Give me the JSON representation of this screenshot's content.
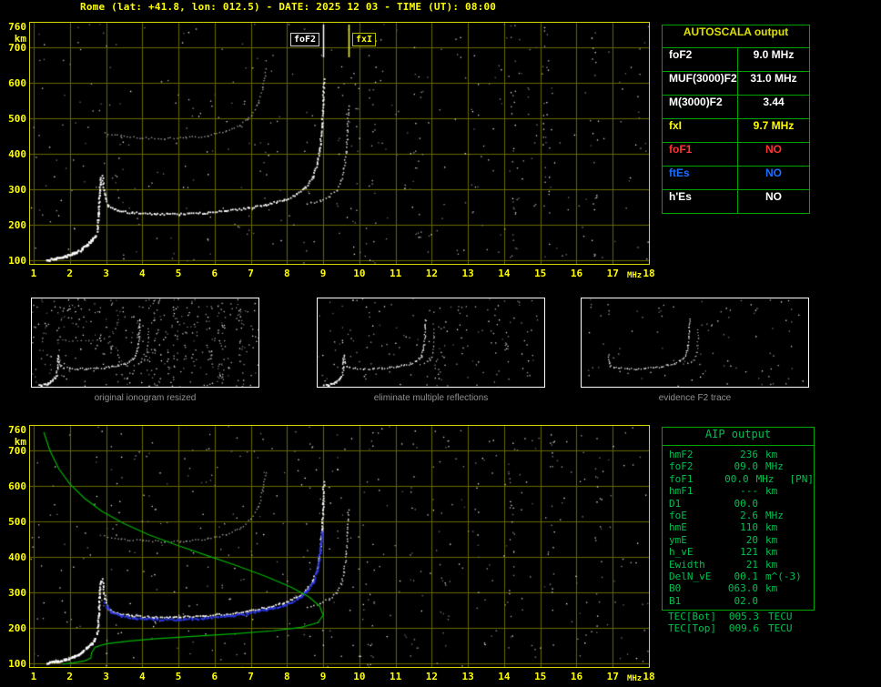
{
  "title": "Rome (lat: +41.8, lon: 012.5) - DATE: 2025 12 03 - TIME (UT): 08:00",
  "colors": {
    "background": "#000000",
    "yellow": "#ffff00",
    "plot_border": "#d8d800",
    "grid": "#666600",
    "table_border": "#00a400",
    "autoscala_header": "#dde000",
    "aip_text": "#00c050",
    "caption_gray": "#909090",
    "white": "#ffffff",
    "red": "#ff3333",
    "blue": "#1a6eff"
  },
  "autoscala_table": {
    "title": "AUTOSCALA output",
    "rows": [
      {
        "param": "foF2",
        "value": "9.0 MHz",
        "color": "#ffffff"
      },
      {
        "param": "MUF(3000)F2",
        "value": "31.0 MHz",
        "color": "#ffffff"
      },
      {
        "param": "M(3000)F2",
        "value": "3.44",
        "color": "#ffffff"
      },
      {
        "param": "fxI",
        "value": "9.7 MHz",
        "color": "#ffff00"
      },
      {
        "param": "foF1",
        "value": "NO",
        "color": "#ff3333"
      },
      {
        "param": "ftEs",
        "value": "NO",
        "color": "#1a6eff"
      },
      {
        "param": "h'Es",
        "value": "NO",
        "color": "#ffffff"
      }
    ]
  },
  "panels": [
    {
      "caption": "original ionogram resized"
    },
    {
      "caption": "eliminate multiple reflections"
    },
    {
      "caption": "evidence F2 trace"
    }
  ],
  "aip_table": {
    "title": "AIP output",
    "rows": [
      {
        "param": "hmF2",
        "value": "236",
        "unit": "km",
        "note": ""
      },
      {
        "param": "foF2",
        "value": "09.0",
        "unit": "MHz",
        "note": ""
      },
      {
        "param": "foF1",
        "value": "00.0",
        "unit": "MHz",
        "note": "[PN]"
      },
      {
        "param": "hmF1",
        "value": "---",
        "unit": "km",
        "note": ""
      },
      {
        "param": "D1",
        "value": "00.0",
        "unit": "",
        "note": ""
      },
      {
        "param": "foE",
        "value": "2.6",
        "unit": "MHz",
        "note": ""
      },
      {
        "param": "hmE",
        "value": "110",
        "unit": "km",
        "note": ""
      },
      {
        "param": "ymE",
        "value": "20",
        "unit": "km",
        "note": ""
      },
      {
        "param": "h_vE",
        "value": "121",
        "unit": "km",
        "note": ""
      },
      {
        "param": "Ewidth",
        "value": "21",
        "unit": "km",
        "note": ""
      },
      {
        "param": "DelN_vE",
        "value": "00.1",
        "unit": "m^(-3)",
        "note": ""
      },
      {
        "param": "B0",
        "value": "063.0",
        "unit": "km",
        "note": ""
      },
      {
        "param": "B1",
        "value": "02.0",
        "unit": "",
        "note": ""
      }
    ],
    "tec_rows": [
      {
        "param": "TEC[Bot]",
        "value": "005.3",
        "unit": "TECU"
      },
      {
        "param": "TEC[Top]",
        "value": "009.6",
        "unit": "TECU"
      }
    ]
  },
  "chart_data": [
    {
      "id": "scaled-ionogram",
      "type": "scatter",
      "title": "",
      "xlabel": "MHz",
      "ylabel": "km",
      "xlim": [
        0.9,
        18.0
      ],
      "ylim": [
        90,
        770
      ],
      "xticks": [
        1,
        2,
        3,
        4,
        5,
        6,
        7,
        8,
        9,
        10,
        11,
        12,
        13,
        14,
        15,
        16,
        17,
        18
      ],
      "yticks": [
        760,
        700,
        600,
        500,
        400,
        300,
        200,
        100
      ],
      "grid": true,
      "legend": "none",
      "annotations": [
        {
          "label": "foF2",
          "x": 9.0,
          "color": "#ffffff"
        },
        {
          "label": "fxI",
          "x": 9.7,
          "color": "#ffff00"
        }
      ],
      "series": [
        {
          "name": "E-region-trace",
          "color": "#ffffff",
          "size": 2.4,
          "step": 1.6,
          "points": [
            [
              1.35,
              103
            ],
            [
              1.6,
              107
            ],
            [
              1.85,
              113
            ],
            [
              2.1,
              122
            ],
            [
              2.3,
              133
            ],
            [
              2.45,
              145
            ],
            [
              2.58,
              158
            ],
            [
              2.68,
              172
            ]
          ]
        },
        {
          "name": "F-cusp",
          "color": "#ffffff",
          "size": 2.0,
          "step": 2.0,
          "points": [
            [
              2.74,
              185
            ],
            [
              2.78,
              235
            ],
            [
              2.8,
              285
            ],
            [
              2.83,
              335
            ]
          ]
        },
        {
          "name": "F2-ordinary",
          "color": "#ffffff",
          "size": 1.8,
          "step": 2.2,
          "points": [
            [
              2.88,
              340
            ],
            [
              2.95,
              285
            ],
            [
              3.05,
              255
            ],
            [
              3.3,
              242
            ],
            [
              3.7,
              236
            ],
            [
              4.3,
              232
            ],
            [
              5.0,
              232
            ],
            [
              5.7,
              235
            ],
            [
              6.3,
              241
            ],
            [
              6.9,
              249
            ],
            [
              7.4,
              259
            ],
            [
              7.9,
              272
            ],
            [
              8.25,
              288
            ],
            [
              8.5,
              308
            ],
            [
              8.7,
              335
            ],
            [
              8.82,
              372
            ],
            [
              8.9,
              420
            ],
            [
              8.95,
              480
            ],
            [
              8.98,
              550
            ],
            [
              9.0,
              612
            ]
          ]
        },
        {
          "name": "F2-extraordinary",
          "color": "#dddddd",
          "size": 1.5,
          "step": 3.0,
          "points": [
            [
              8.55,
              262
            ],
            [
              8.9,
              270
            ],
            [
              9.15,
              283
            ],
            [
              9.35,
              300
            ],
            [
              9.48,
              325
            ],
            [
              9.56,
              360
            ],
            [
              9.62,
              410
            ],
            [
              9.66,
              470
            ],
            [
              9.68,
              535
            ]
          ]
        },
        {
          "name": "second-hop-trace",
          "color": "#9a9a9a",
          "size": 1.4,
          "step": 3.2,
          "points": [
            [
              2.95,
              460
            ],
            [
              3.4,
              452
            ],
            [
              4.0,
              447
            ],
            [
              4.6,
              445
            ],
            [
              5.2,
              447
            ],
            [
              5.8,
              453
            ],
            [
              6.3,
              465
            ],
            [
              6.7,
              483
            ],
            [
              7.0,
              510
            ],
            [
              7.2,
              545
            ],
            [
              7.32,
              590
            ],
            [
              7.4,
              640
            ]
          ]
        }
      ],
      "noise": {
        "count": 380,
        "columns": [
          {
            "x": 9.9,
            "count": 12
          },
          {
            "x": 10.35,
            "count": 16
          },
          {
            "x": 11.6,
            "count": 14
          },
          {
            "x": 14.25,
            "count": 22
          },
          {
            "x": 15.15,
            "count": 26
          },
          {
            "x": 16.5,
            "count": 18
          }
        ]
      }
    },
    {
      "id": "ionogram-with-profile",
      "type": "scatter",
      "title": "",
      "xlabel": "MHz",
      "ylabel": "km",
      "xlim": [
        0.9,
        18.0
      ],
      "ylim": [
        90,
        770
      ],
      "xticks": [
        1,
        2,
        3,
        4,
        5,
        6,
        7,
        8,
        9,
        10,
        11,
        12,
        13,
        14,
        15,
        16,
        17,
        18
      ],
      "yticks": [
        760,
        700,
        600,
        500,
        400,
        300,
        200,
        100
      ],
      "grid": true,
      "legend": "none",
      "annotations": [],
      "series": [
        {
          "name": "E-region-trace",
          "color": "#ffffff",
          "size": 2.4,
          "step": 1.6,
          "points": [
            [
              1.35,
              103
            ],
            [
              1.6,
              107
            ],
            [
              1.85,
              113
            ],
            [
              2.1,
              122
            ],
            [
              2.3,
              133
            ],
            [
              2.45,
              145
            ],
            [
              2.58,
              158
            ],
            [
              2.68,
              172
            ]
          ]
        },
        {
          "name": "F-cusp",
          "color": "#ffffff",
          "size": 2.0,
          "step": 2.0,
          "points": [
            [
              2.74,
              185
            ],
            [
              2.78,
              235
            ],
            [
              2.8,
              285
            ],
            [
              2.83,
              335
            ]
          ]
        },
        {
          "name": "F2-ordinary",
          "color": "#ffffff",
          "size": 1.8,
          "step": 2.2,
          "points": [
            [
              2.88,
              340
            ],
            [
              2.95,
              285
            ],
            [
              3.05,
              255
            ],
            [
              3.3,
              242
            ],
            [
              3.7,
              236
            ],
            [
              4.3,
              232
            ],
            [
              5.0,
              232
            ],
            [
              5.7,
              235
            ],
            [
              6.3,
              241
            ],
            [
              6.9,
              249
            ],
            [
              7.4,
              259
            ],
            [
              7.9,
              272
            ],
            [
              8.25,
              288
            ],
            [
              8.5,
              308
            ],
            [
              8.7,
              335
            ],
            [
              8.82,
              372
            ],
            [
              8.9,
              420
            ],
            [
              8.95,
              480
            ],
            [
              8.98,
              550
            ],
            [
              9.0,
              612
            ]
          ]
        },
        {
          "name": "F2-extraordinary",
          "color": "#dddddd",
          "size": 1.5,
          "step": 3.0,
          "points": [
            [
              8.55,
              262
            ],
            [
              8.9,
              270
            ],
            [
              9.15,
              283
            ],
            [
              9.35,
              300
            ],
            [
              9.48,
              325
            ],
            [
              9.56,
              360
            ],
            [
              9.62,
              410
            ],
            [
              9.66,
              470
            ],
            [
              9.68,
              535
            ]
          ]
        },
        {
          "name": "second-hop-trace",
          "color": "#9a9a9a",
          "size": 1.4,
          "step": 3.2,
          "points": [
            [
              2.95,
              460
            ],
            [
              3.4,
              452
            ],
            [
              4.0,
              447
            ],
            [
              4.6,
              445
            ],
            [
              5.2,
              447
            ],
            [
              5.8,
              453
            ],
            [
              6.3,
              465
            ],
            [
              6.7,
              483
            ],
            [
              7.0,
              510
            ],
            [
              7.2,
              545
            ],
            [
              7.32,
              590
            ],
            [
              7.4,
              640
            ]
          ]
        },
        {
          "name": "autoscala-fitted-F2-trace",
          "color": "#2936e6",
          "size": 2.2,
          "step": 2.0,
          "points": [
            [
              2.95,
              272
            ],
            [
              3.1,
              248
            ],
            [
              3.4,
              236
            ],
            [
              3.8,
              230
            ],
            [
              4.4,
              226
            ],
            [
              5.0,
              226
            ],
            [
              5.7,
              229
            ],
            [
              6.3,
              235
            ],
            [
              6.9,
              243
            ],
            [
              7.4,
              253
            ],
            [
              7.9,
              266
            ],
            [
              8.25,
              282
            ],
            [
              8.5,
              302
            ],
            [
              8.7,
              330
            ],
            [
              8.82,
              368
            ],
            [
              8.9,
              418
            ],
            [
              8.95,
              476
            ]
          ]
        },
        {
          "name": "electron-density-profile",
          "color": "#00b400",
          "style": "line",
          "points": [
            [
              1.28,
              752
            ],
            [
              1.45,
              700
            ],
            [
              1.7,
              648
            ],
            [
              2.0,
              606
            ],
            [
              2.4,
              566
            ],
            [
              2.9,
              528
            ],
            [
              3.5,
              494
            ],
            [
              4.2,
              462
            ],
            [
              5.0,
              432
            ],
            [
              5.8,
              404
            ],
            [
              6.6,
              376
            ],
            [
              7.4,
              346
            ],
            [
              8.1,
              316
            ],
            [
              8.6,
              288
            ],
            [
              8.9,
              262
            ],
            [
              9.0,
              236
            ],
            [
              8.85,
              215
            ],
            [
              8.4,
              202
            ],
            [
              7.6,
              192
            ],
            [
              6.6,
              184
            ],
            [
              5.5,
              177
            ],
            [
              4.4,
              170
            ],
            [
              3.6,
              163
            ],
            [
              3.0,
              155
            ],
            [
              2.7,
              146
            ],
            [
              2.6,
              130
            ],
            [
              2.58,
              115
            ],
            [
              2.4,
              107
            ],
            [
              2.1,
              102
            ],
            [
              1.8,
              98
            ]
          ]
        }
      ],
      "noise": {
        "count": 430,
        "columns": [
          {
            "x": 10.3,
            "count": 14
          },
          {
            "x": 11.5,
            "count": 12
          },
          {
            "x": 12.4,
            "count": 10
          },
          {
            "x": 14.2,
            "count": 20
          },
          {
            "x": 15.3,
            "count": 16
          },
          {
            "x": 16.6,
            "count": 14
          }
        ]
      }
    }
  ]
}
